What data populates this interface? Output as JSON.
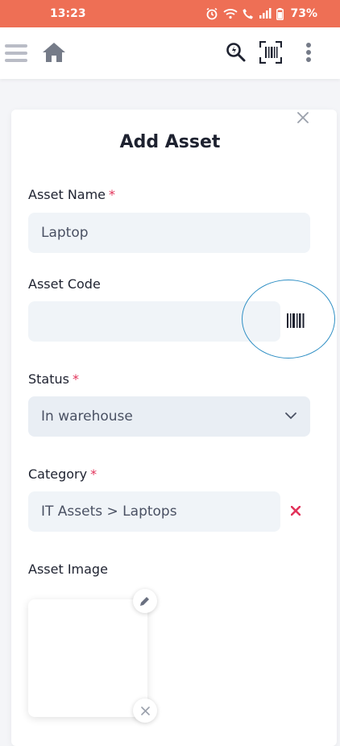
{
  "status_bar": {
    "time": "13:23",
    "battery": "73%"
  },
  "modal": {
    "title": "Add Asset",
    "required_mark": "*"
  },
  "fields": {
    "asset_name": {
      "label": "Asset Name",
      "value": "Laptop"
    },
    "asset_code": {
      "label": "Asset Code",
      "value": ""
    },
    "status": {
      "label": "Status",
      "value": "In warehouse"
    },
    "category": {
      "label": "Category",
      "value": "IT Assets > Laptops"
    },
    "asset_image": {
      "label": "Asset Image"
    }
  },
  "icons": {
    "menu": "menu-icon",
    "home": "home-icon",
    "search": "search-icon",
    "barcode": "barcode-icon",
    "more": "more-vert-icon",
    "close": "close-icon",
    "clear": "clear-icon",
    "edit": "pencil-icon"
  },
  "colors": {
    "status_bar": "#ee6f55",
    "required": "#e2345b",
    "highlight_circle": "#2f8fc4"
  }
}
